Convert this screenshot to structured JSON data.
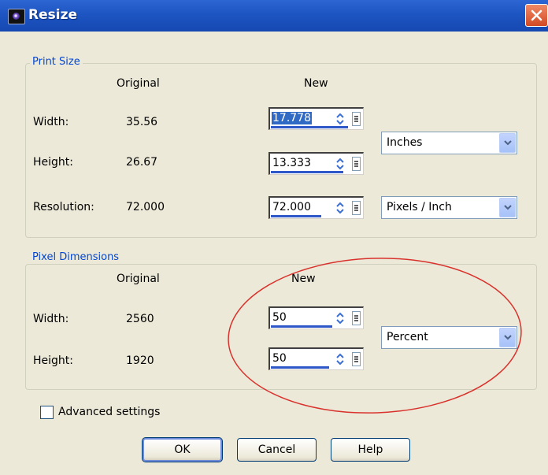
{
  "window": {
    "title": "Resize"
  },
  "print_size": {
    "group_label": "Print Size",
    "col_original": "Original",
    "col_new": "New",
    "width_label": "Width:",
    "width_original": "35.56",
    "width_new": "17.778",
    "height_label": "Height:",
    "height_original": "26.67",
    "height_new": "13.333",
    "resolution_label": "Resolution:",
    "resolution_original": "72.000",
    "resolution_new": "72.000",
    "units_value": "Inches",
    "resolution_units_value": "Pixels / Inch"
  },
  "pixel_dimensions": {
    "group_label": "Pixel Dimensions",
    "col_original": "Original",
    "col_new": "New",
    "width_label": "Width:",
    "width_original": "2560",
    "width_new": "50",
    "height_label": "Height:",
    "height_original": "1920",
    "height_new": "50",
    "units_value": "Percent"
  },
  "options": {
    "advanced_label": "Advanced settings",
    "advanced_checked": false
  },
  "buttons": {
    "ok": "OK",
    "cancel": "Cancel",
    "help": "Help"
  },
  "colors": {
    "title_bar": "#1d55c2",
    "group_title": "#0046d5",
    "annotation": "#d9312c",
    "dialog_bg": "#ece9d8"
  }
}
